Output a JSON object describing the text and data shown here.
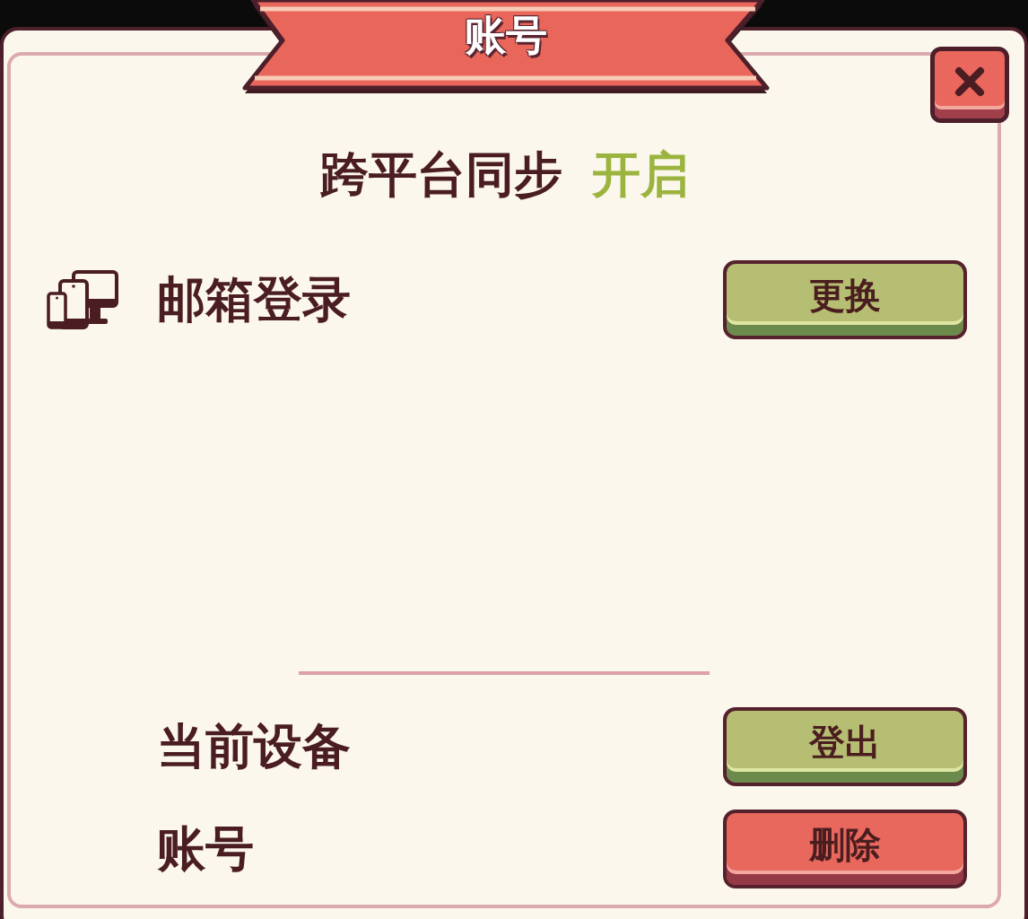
{
  "banner": {
    "title": "账号"
  },
  "sync": {
    "label": "跨平台同步",
    "status": "开启",
    "on": true
  },
  "login": {
    "method": "邮箱登录",
    "button": {
      "label": "更换",
      "kind": "confirm"
    }
  },
  "account_rows": [
    {
      "label": "当前设备",
      "button": {
        "label": "登出",
        "kind": "confirm"
      }
    },
    {
      "label": "账号",
      "button": {
        "label": "删除",
        "kind": "danger"
      }
    }
  ]
}
